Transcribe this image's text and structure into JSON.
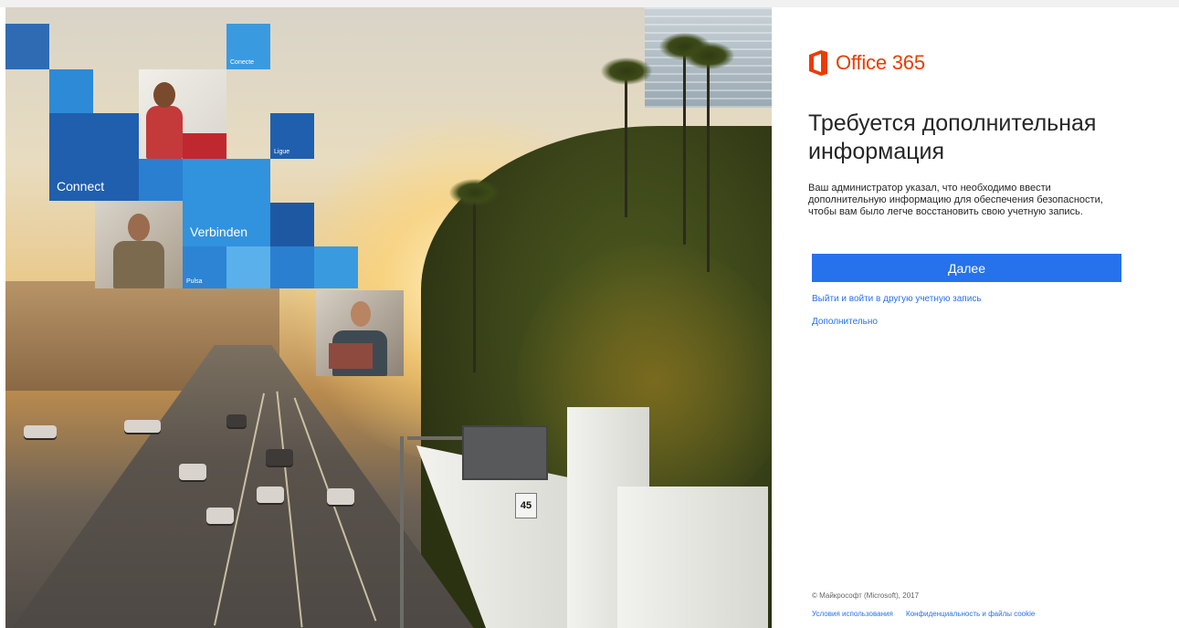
{
  "hero": {
    "tiles": [
      "Connect",
      "Verbinden",
      "Conecte",
      "Ligue",
      "Pulsa"
    ],
    "speed_sign": "45"
  },
  "brand": {
    "logo_text": "Office 365",
    "accent": "#eb3c00",
    "link_color": "#2672ec"
  },
  "panel": {
    "heading": "Требуется дополнительная информация",
    "description": "Ваш администратор указал, что необходимо ввести дополнительную информацию для обеспечения безопасности, чтобы вам было легче восстановить свою учетную запись.",
    "next_button": "Далее",
    "links": {
      "switch_account": "Выйти и войти в другую учетную запись",
      "more": "Дополнительно"
    }
  },
  "footer": {
    "copyright": "© Майкрософт (Microsoft), 2017",
    "terms": "Условия использования",
    "privacy": "Конфиденциальность и файлы cookie"
  }
}
